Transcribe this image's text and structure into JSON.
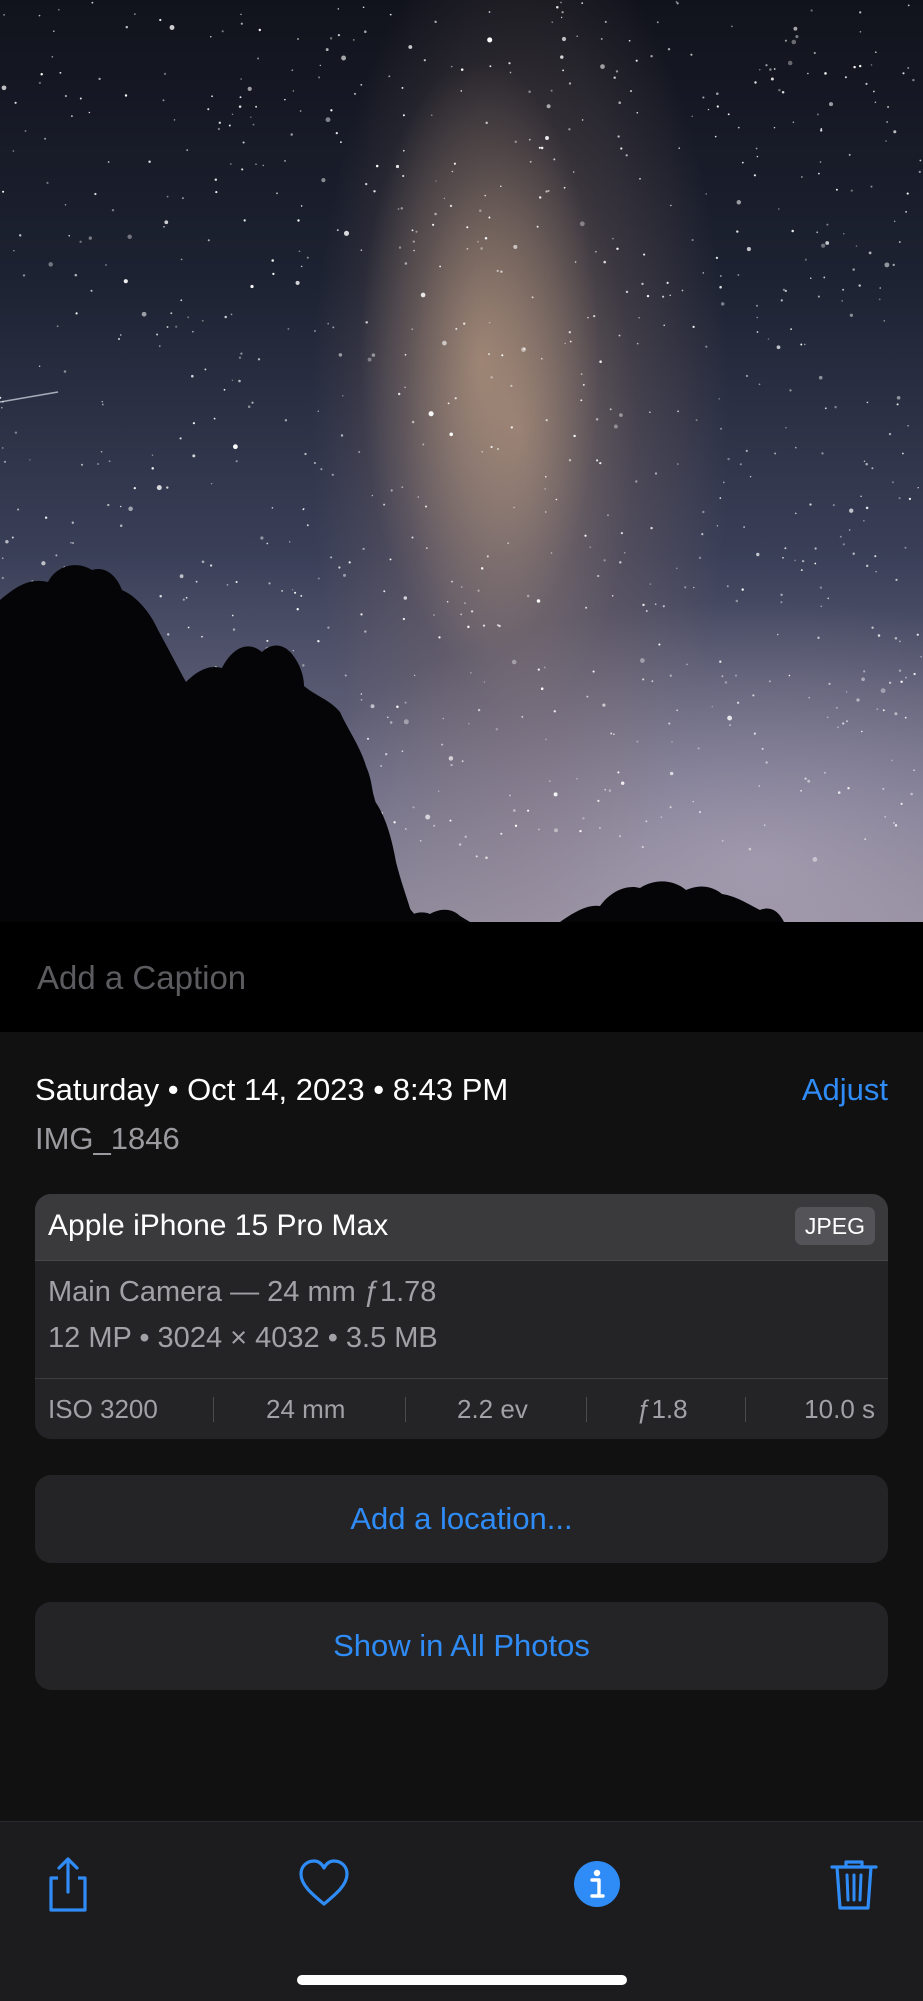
{
  "photo": {
    "description_icon": "milky-way-photo"
  },
  "caption": {
    "placeholder": "Add a Caption"
  },
  "info": {
    "date": "Saturday • Oct 14, 2023 • 8:43 PM",
    "adjust_label": "Adjust",
    "filename": "IMG_1846"
  },
  "metadata": {
    "device": "Apple iPhone 15 Pro Max",
    "format": "JPEG",
    "lens": "Main Camera — 24 mm ƒ1.78",
    "specs": "12 MP  •  3024 × 4032  •  3.5 MB",
    "exif": {
      "iso": "ISO 3200",
      "focal": "24 mm",
      "ev": "2.2 ev",
      "aperture": "ƒ1.8",
      "shutter": "10.0 s"
    }
  },
  "actions": {
    "add_location": "Add a location...",
    "show_all_photos": "Show in All Photos"
  },
  "toolbar": {
    "icons": [
      "share-icon",
      "heart-icon",
      "info-icon",
      "trash-icon"
    ]
  },
  "colors": {
    "accent": "#2f8cf6",
    "background": "#111111",
    "card": "#242426",
    "toolbar": "#1c1c1e"
  }
}
